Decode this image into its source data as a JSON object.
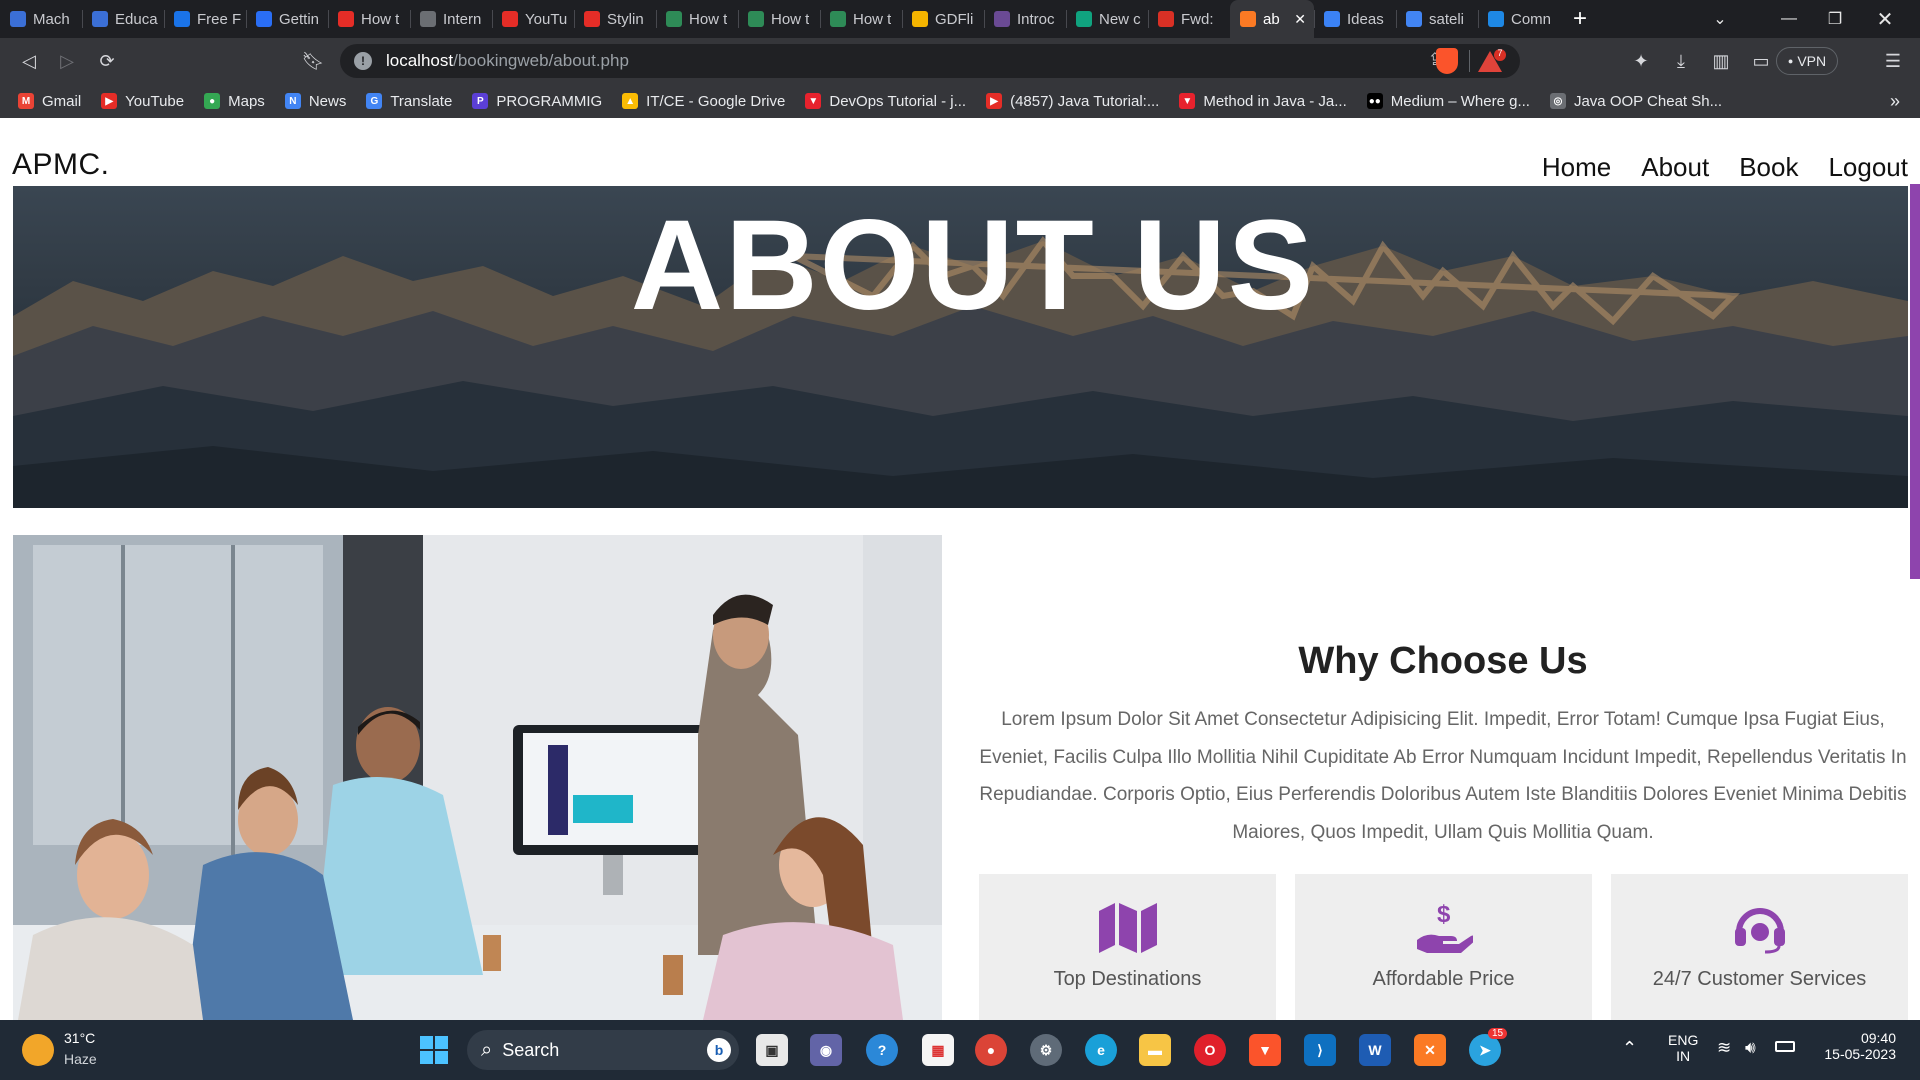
{
  "browser": {
    "tabs": [
      {
        "title": "Mach",
        "color": "#3b6fd6"
      },
      {
        "title": "Educa",
        "color": "#3b6fd6"
      },
      {
        "title": "Free F",
        "color": "#1a73e8"
      },
      {
        "title": "Gettin",
        "color": "#2a6ef5"
      },
      {
        "title": "How t",
        "color": "#e52d27"
      },
      {
        "title": "Intern",
        "color": "#6b6e73"
      },
      {
        "title": "YouTu",
        "color": "#e52d27"
      },
      {
        "title": "Stylin",
        "color": "#e52d27"
      },
      {
        "title": "How t",
        "color": "#2e8b57"
      },
      {
        "title": "How t",
        "color": "#2e8b57"
      },
      {
        "title": "How t",
        "color": "#2e8b57"
      },
      {
        "title": "GDFli",
        "color": "#f4b400"
      },
      {
        "title": "Introc",
        "color": "#6a4a94"
      },
      {
        "title": "New c",
        "color": "#10a37f"
      },
      {
        "title": "Fwd:",
        "color": "#d93025"
      },
      {
        "title": "ab",
        "color": "#fb7a24",
        "active": true
      },
      {
        "title": "Ideas",
        "color": "#3b82f6"
      },
      {
        "title": "sateli",
        "color": "#4285f4"
      },
      {
        "title": "Comn",
        "color": "#1e88e5"
      }
    ],
    "url_host": "localhost",
    "url_path": "/bookingweb/about.php",
    "vpn_label": "VPN",
    "brave_badge": "7",
    "bookmarks": [
      {
        "label": "Gmail",
        "color": "#ea4335",
        "glyph": "M"
      },
      {
        "label": "YouTube",
        "color": "#e52d27",
        "glyph": "▶"
      },
      {
        "label": "Maps",
        "color": "#34a853",
        "glyph": "●"
      },
      {
        "label": "News",
        "color": "#4285f4",
        "glyph": "N"
      },
      {
        "label": "Translate",
        "color": "#4285f4",
        "glyph": "G"
      },
      {
        "label": "PROGRAMMIG",
        "color": "#5b3fd6",
        "glyph": "P"
      },
      {
        "label": "IT/CE - Google Drive",
        "color": "#fbbc04",
        "glyph": "▲"
      },
      {
        "label": "DevOps Tutorial - j...",
        "color": "#e8222d",
        "glyph": "▼"
      },
      {
        "label": "(4857) Java Tutorial:...",
        "color": "#e52d27",
        "glyph": "▶"
      },
      {
        "label": "Method in Java - Ja...",
        "color": "#e8222d",
        "glyph": "▼"
      },
      {
        "label": "Medium – Where g...",
        "color": "#000000",
        "glyph": "●●"
      },
      {
        "label": "Java OOP Cheat Sh...",
        "color": "#6b6e73",
        "glyph": "◎"
      }
    ]
  },
  "site": {
    "logo": "APMC.",
    "nav": [
      "Home",
      "About",
      "Book",
      "Logout"
    ],
    "hero_title": "ABOUT US",
    "why_title": "Why Choose Us",
    "why_text": "Lorem Ipsum Dolor Sit Amet Consectetur Adipisicing Elit. Impedit, Error Totam! Cumque Ipsa Fugiat Eius, Eveniet, Facilis Culpa Illo Mollitia Nihil Cupiditate Ab Error Numquam Incidunt Impedit, Repellendus Veritatis In Repudiandae. Corporis Optio, Eius Perferendis Doloribus Autem Iste Blanditiis Dolores Eveniet Minima Debitis Maiores, Quos Impedit, Ullam Quis Mollitia Quam.",
    "features": [
      {
        "label": "Top Destinations",
        "icon": "map-icon"
      },
      {
        "label": "Affordable Price",
        "icon": "hand-dollar-icon"
      },
      {
        "label": "24/7 Customer Services",
        "icon": "headset-icon"
      }
    ],
    "accent_color": "#8e44ad"
  },
  "taskbar": {
    "weather_temp": "31°C",
    "weather_desc": "Haze",
    "search_label": "Search",
    "lang_top": "ENG",
    "lang_bottom": "IN",
    "time": "09:40",
    "date": "15-05-2023",
    "telegram_badge": "15"
  }
}
